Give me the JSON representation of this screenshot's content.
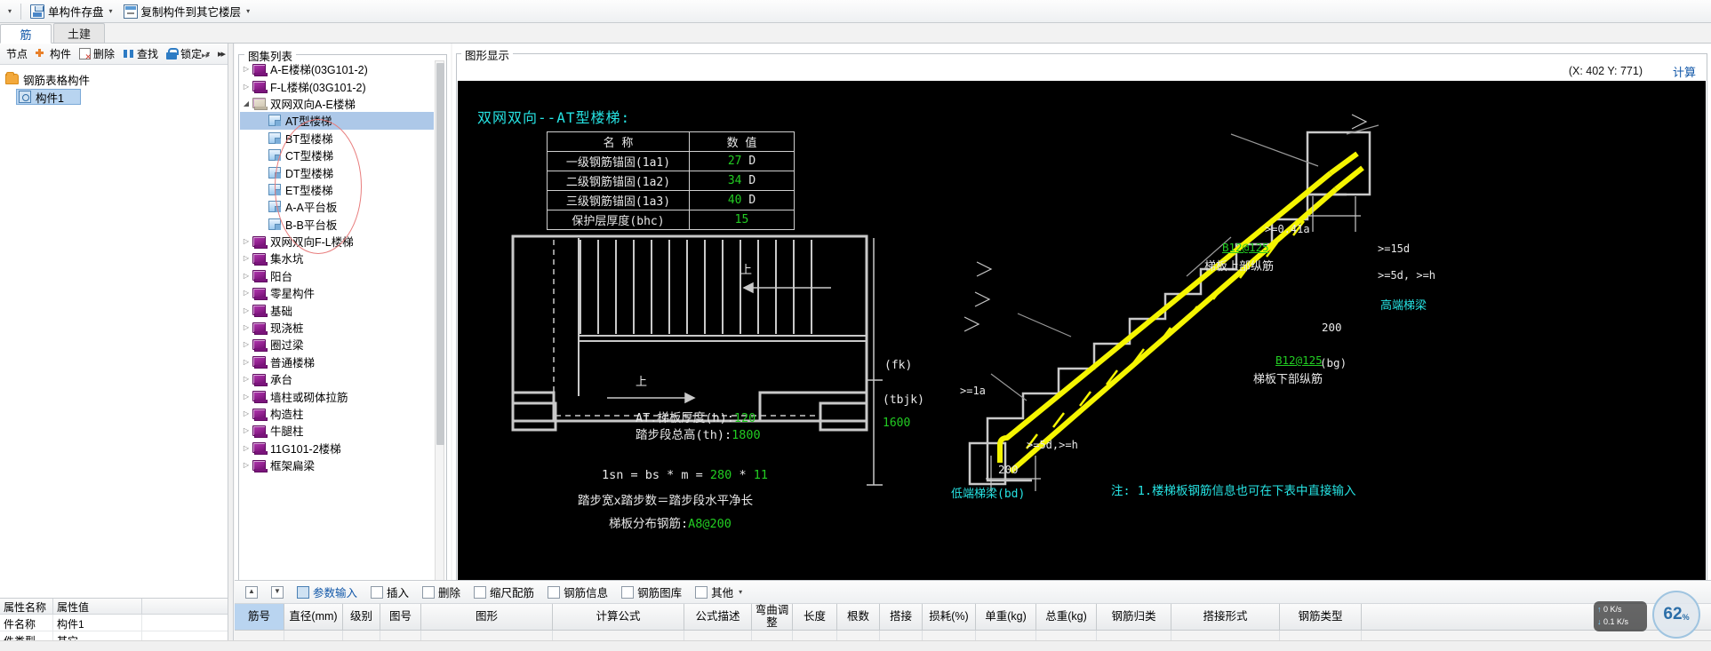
{
  "toolbar": {
    "items": [
      {
        "label": "单构件存盘",
        "icon": "save-icon",
        "caret": true
      },
      {
        "label": "复制构件到其它楼层",
        "icon": "copy-icon",
        "caret": true
      }
    ],
    "leading_caret": "▾"
  },
  "tabs": [
    {
      "label": "筋",
      "active": true
    },
    {
      "label": "土建",
      "active": false
    }
  ],
  "left_panel": {
    "toolbar": [
      {
        "label": "节点",
        "icon": "node-icon"
      },
      {
        "label": "构件",
        "icon": "add-component-icon"
      },
      {
        "label": "删除",
        "icon": "delete-icon"
      },
      {
        "label": "查找",
        "icon": "find-icon"
      },
      {
        "label": "锁定",
        "icon": "lock-icon",
        "caret": "▾"
      }
    ],
    "more": "▸▸",
    "tree": {
      "root": "钢筋表格构件",
      "children": [
        {
          "label": "构件1",
          "selected": true
        }
      ]
    },
    "properties": {
      "headers": [
        "属性名称",
        "属性值"
      ],
      "rows": [
        [
          "件名称",
          "构件1"
        ],
        [
          "件类型",
          "其它"
        ]
      ]
    }
  },
  "atlas": {
    "title": "图集列表",
    "items": [
      {
        "label": "A-E楼梯(03G101-2)",
        "level": 0,
        "arrow": "▷",
        "icon": "book-icon"
      },
      {
        "label": "F-L楼梯(03G101-2)",
        "level": 0,
        "arrow": "▷",
        "icon": "book-icon"
      },
      {
        "label": "双网双向A-E楼梯",
        "level": 0,
        "arrow": "◢",
        "icon": "open-book-icon"
      },
      {
        "label": "AT型楼梯",
        "level": 1,
        "arrow": "",
        "icon": "page-icon",
        "selected": true
      },
      {
        "label": "BT型楼梯",
        "level": 1,
        "arrow": "",
        "icon": "page-icon"
      },
      {
        "label": "CT型楼梯",
        "level": 1,
        "arrow": "",
        "icon": "page-icon"
      },
      {
        "label": "DT型楼梯",
        "level": 1,
        "arrow": "",
        "icon": "page-icon"
      },
      {
        "label": "ET型楼梯",
        "level": 1,
        "arrow": "",
        "icon": "page-icon"
      },
      {
        "label": "A-A平台板",
        "level": 1,
        "arrow": "",
        "icon": "page-icon"
      },
      {
        "label": "B-B平台板",
        "level": 1,
        "arrow": "",
        "icon": "page-icon"
      },
      {
        "label": "双网双向F-L楼梯",
        "level": 0,
        "arrow": "▷",
        "icon": "book-icon"
      },
      {
        "label": "集水坑",
        "level": 0,
        "arrow": "▷",
        "icon": "book-icon"
      },
      {
        "label": "阳台",
        "level": 0,
        "arrow": "▷",
        "icon": "book-icon"
      },
      {
        "label": "零星构件",
        "level": 0,
        "arrow": "▷",
        "icon": "book-icon"
      },
      {
        "label": "基础",
        "level": 0,
        "arrow": "▷",
        "icon": "book-icon"
      },
      {
        "label": "现浇桩",
        "level": 0,
        "arrow": "▷",
        "icon": "book-icon"
      },
      {
        "label": "圈过梁",
        "level": 0,
        "arrow": "▷",
        "icon": "book-icon"
      },
      {
        "label": "普通楼梯",
        "level": 0,
        "arrow": "▷",
        "icon": "book-icon"
      },
      {
        "label": "承台",
        "level": 0,
        "arrow": "▷",
        "icon": "book-icon"
      },
      {
        "label": "墙柱或砌体拉筋",
        "level": 0,
        "arrow": "▷",
        "icon": "book-icon"
      },
      {
        "label": "构造柱",
        "level": 0,
        "arrow": "▷",
        "icon": "book-icon"
      },
      {
        "label": "牛腿柱",
        "level": 0,
        "arrow": "▷",
        "icon": "book-icon"
      },
      {
        "label": "11G101-2楼梯",
        "level": 0,
        "arrow": "▷",
        "icon": "book-icon"
      },
      {
        "label": "框架扁梁",
        "level": 0,
        "arrow": "▷",
        "icon": "book-icon"
      }
    ]
  },
  "display": {
    "title": "图形显示",
    "coordinate": "(X: 402 Y: 771)",
    "calc_button": "计算",
    "drawing": {
      "title": "双网双向--AT型楼梯:",
      "param_table": {
        "headers": [
          "名  称",
          "数  值"
        ],
        "rows": [
          {
            "name": "一级钢筋锚固(1a1)",
            "value": "27",
            "unit": "D"
          },
          {
            "name": "二级钢筋锚固(1a2)",
            "value": "34",
            "unit": "D"
          },
          {
            "name": "三级钢筋锚固(1a3)",
            "value": "40",
            "unit": "D"
          },
          {
            "name": "保护层厚度(bhc)",
            "value": "15",
            "unit": ""
          }
        ]
      },
      "plan_labels": {
        "thickness_label": "AT.梯板厚度(h):",
        "thickness_value": "120",
        "total_height_label": "踏步段总高(th):",
        "total_height_value": "1800",
        "up_arrow_1": "上",
        "up_arrow_2": "上",
        "formula": "1sn = bs * m = ",
        "formula_v1": "280",
        "formula_sep": " * ",
        "formula_v2": "11",
        "formula_desc": "踏步宽x踏步数＝踏步段水平净长",
        "distribution_label": "梯板分布钢筋:",
        "distribution_value": "A8@200",
        "fk": "(fk)",
        "tbjk": "(tbjk)",
        "tbjk_value": "1600"
      },
      "section_labels": {
        "top_rebar_spec": "B12@125",
        "top_rebar_name": "梯板上部纵筋",
        "bottom_rebar_spec": "B12@125",
        "bottom_rebar_name": "梯板下部纵筋",
        "high_beam": "高端梯梁",
        "low_beam": "低端梯梁(bd)",
        "dim_200_left": "200",
        "dim_200_right": "200",
        "bg": "(bg)",
        "ge_041a": ">=0.41a",
        "ge_5d_1": ">=5d,>=h",
        "ge_5d_2": ">=5d, >=h",
        "ge_1a": ">=1a",
        "ge_15d": ">=15d",
        "note": "注: 1.楼梯板钢筋信息也可在下表中直接输入"
      }
    }
  },
  "bottom": {
    "toolbar": [
      {
        "label": "",
        "icon": "up-arrow-icon"
      },
      {
        "label": "",
        "icon": "down-arrow-icon"
      },
      {
        "label": "参数输入",
        "icon": "param-icon",
        "accent": true
      },
      {
        "label": "插入",
        "icon": "insert-icon"
      },
      {
        "label": "删除",
        "icon": "delete-icon"
      },
      {
        "label": "缩尺配筋",
        "icon": "scale-icon"
      },
      {
        "label": "钢筋信息",
        "icon": "rebar-info-icon"
      },
      {
        "label": "钢筋图库",
        "icon": "rebar-lib-icon"
      },
      {
        "label": "其他",
        "icon": "other-icon",
        "caret": "▾"
      }
    ],
    "grid_headers": [
      "筋号",
      "直径(mm)",
      "级别",
      "图号",
      "图形",
      "计算公式",
      "公式描述",
      "弯曲调整",
      "长度",
      "根数",
      "搭接",
      "损耗(%)",
      "单重(kg)",
      "总重(kg)",
      "钢筋归类",
      "搭接形式",
      "钢筋类型"
    ]
  },
  "status": {
    "net_up": "0 K/s",
    "net_down": "0.1 K/s",
    "zoom_value": "62",
    "zoom_unit": "%"
  },
  "colors": {
    "accent": "#1157a8",
    "cad_cyan": "#26e3e3",
    "cad_green": "#22cc22",
    "cad_yellow": "#f5f500",
    "selection": "#b8d4f0"
  }
}
